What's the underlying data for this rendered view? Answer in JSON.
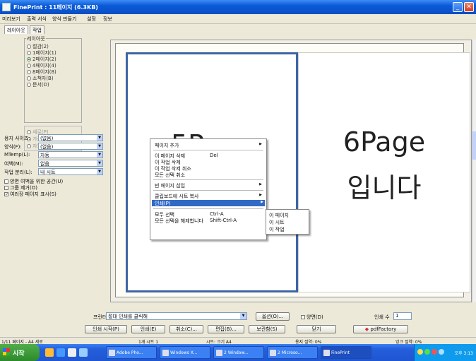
{
  "titlebar": {
    "title": "FinePrint : 11페이지 (6.3KB)",
    "min_glyph": "_",
    "close_glyph": "✕"
  },
  "menubar": {
    "items": [
      "미리보기",
      "출력 서식",
      "양식 만들기",
      "설정",
      "정보"
    ]
  },
  "left_panel": {
    "tabs": [
      "레이아웃",
      "작업"
    ],
    "layout_group": {
      "legend": "레이아웃",
      "options": [
        {
          "label": "절감(2)",
          "selected": false
        },
        {
          "label": "1페이지(1)",
          "selected": false
        },
        {
          "label": "2페이지(2)",
          "selected": true
        },
        {
          "label": "4페이지(4)",
          "selected": false
        },
        {
          "label": "8페이지(8)",
          "selected": false
        },
        {
          "label": "소책자(B)",
          "selected": false
        },
        {
          "label": "문서(D)",
          "selected": false
        }
      ]
    },
    "sub_group": {
      "options": [
        {
          "label": "세로(P)"
        },
        {
          "label": "가로(L)"
        },
        {
          "label": "자동(A)"
        }
      ]
    },
    "settings": [
      {
        "label": "용지 사이즈:",
        "value": "(없음)"
      },
      {
        "label": "양식(F):",
        "value": "(없음)"
      },
      {
        "label": "MTemp(L):",
        "value": "자동"
      },
      {
        "label": "여백(M):",
        "value": "없음"
      },
      {
        "label": "작업 분리(L):",
        "value": "내 시트"
      }
    ],
    "checks": [
      {
        "label": "양면 여백을 위한 공간(U)",
        "checked": false
      },
      {
        "label": "그룹 제거(O)",
        "checked": false
      },
      {
        "label": "여러장 페이지 표시(S)",
        "checked": true
      }
    ]
  },
  "preview": {
    "left_page_line1": "5Page",
    "right_page_line1": "6Page",
    "right_page_line2": "입니다"
  },
  "context_menu": {
    "items": [
      {
        "label": "페이지 추가",
        "shortcut": "",
        "has_sub": true
      },
      {
        "label": "이 페이지 삭제",
        "shortcut": "Del",
        "has_sub": false
      },
      {
        "label": "이 작업 삭제",
        "shortcut": "",
        "has_sub": false
      },
      {
        "label": "이 작업 삭제 취소",
        "shortcut": "",
        "has_sub": false
      },
      {
        "label": "모든 선택 취소",
        "shortcut": "",
        "has_sub": false
      },
      {
        "label": "빈 페이지 삽입",
        "shortcut": "",
        "has_sub": true
      },
      {
        "label": "클립보드에 시트 복사",
        "shortcut": "",
        "has_sub": true
      },
      {
        "label": "인쇄(P)",
        "shortcut": "",
        "has_sub": true
      },
      {
        "label": "모두 선택",
        "shortcut": "Ctrl-A",
        "has_sub": false
      },
      {
        "label": "모든 선택을 해제합니다",
        "shortcut": "Shift-Ctrl-A",
        "has_sub": false
      }
    ],
    "submenu": [
      "이 페이지",
      "이 시트",
      "이 작업"
    ]
  },
  "bottom": {
    "printer_label": "프린터",
    "printer_value": "절대 인쇄를 클릭해",
    "properties_button": "옵션(O)...",
    "duplex_label": "양면(D)",
    "copies_label": "인쇄 수",
    "copies_value": "1",
    "buttons": [
      "인쇄 시작(P)",
      "인쇄(E)",
      "취소(C)...",
      "편집(B)...",
      "보관함(S)",
      "닫기"
    ],
    "pdf_button": "pdfFactory"
  },
  "statusbar": {
    "cells": [
      "1/11 페이지 - A4 세로",
      "1개 시트 1",
      "시트: 크기 A4",
      "용지 절약: 0%",
      "잉크 절약: 0%"
    ]
  },
  "taskbar": {
    "start_label": "시작",
    "tasks": [
      {
        "label": "Adobe Pho...",
        "active": false
      },
      {
        "label": "Windows X...",
        "active": false
      },
      {
        "label": "2 Window...",
        "active": false
      },
      {
        "label": "2 Microso...",
        "active": false
      },
      {
        "label": "FinePrint",
        "active": true
      }
    ],
    "clock": "오후 3:13"
  },
  "colors": {
    "accent": "#316ac5",
    "page_border": "#3d65a6",
    "taskbar": "#245edb",
    "start": "#2d8a2a"
  }
}
